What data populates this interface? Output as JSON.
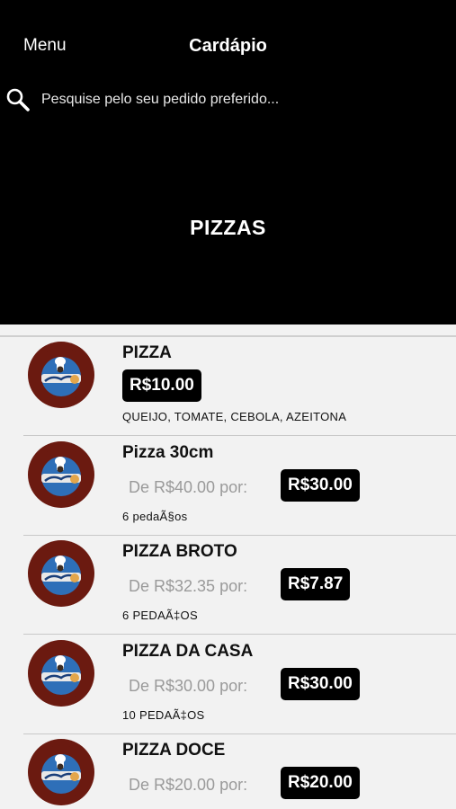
{
  "header": {
    "menu_label": "Menu",
    "title": "Cardápio",
    "search_placeholder": "Pesquise pelo seu pedido preferido...",
    "category_title": "PIZZAS"
  },
  "items": [
    {
      "name": "PIZZA",
      "old_price": "",
      "price": "R$10.00",
      "description": "QUEIJO, TOMATE, CEBOLA, AZEITONA"
    },
    {
      "name": "Pizza 30cm",
      "old_price": "De R$40.00 por:",
      "price": "R$30.00",
      "description": "6 pedaÃ§os"
    },
    {
      "name": "PIZZA BROTO",
      "old_price": "De R$32.35 por:",
      "price": "R$7.87",
      "description": "6 PEDAÃ‡OS"
    },
    {
      "name": "PIZZA DA CASA",
      "old_price": "De R$30.00 por:",
      "price": "R$30.00",
      "description": "10 PEDAÃ‡OS"
    },
    {
      "name": "PIZZA DOCE",
      "old_price": "De R$20.00 por:",
      "price": "R$20.00",
      "description": ""
    }
  ],
  "colors": {
    "header_bg": "#000000",
    "list_bg": "#f2f2f2",
    "price_badge_bg": "#000000",
    "logo_ring": "#6b1a10",
    "logo_inner": "#2e6fb8"
  },
  "icons": {
    "search": "search-icon",
    "logo": "restaurant-logo"
  }
}
